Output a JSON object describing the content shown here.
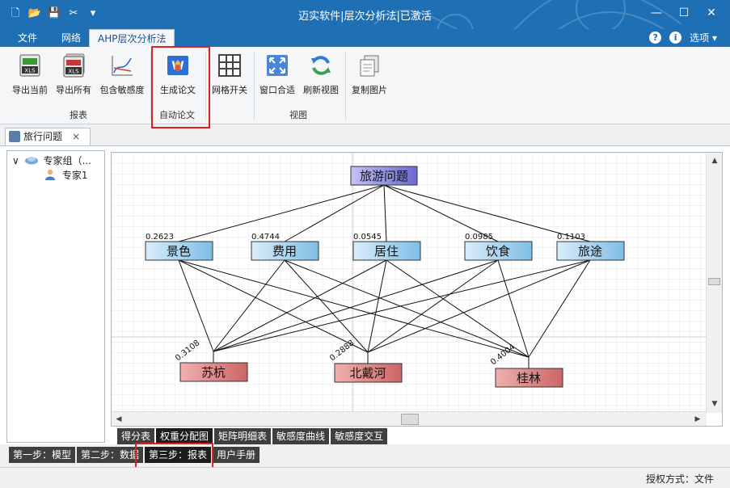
{
  "app": {
    "title": "迈实软件|层次分析法|已激活"
  },
  "menu": {
    "tabs": [
      "文件",
      "网络",
      "AHP层次分析法"
    ],
    "options_label": "选项"
  },
  "ribbon": {
    "buttons": {
      "export_current": "导出当前",
      "export_all": "导出所有",
      "include_sensitivity": "包含敏感度",
      "generate_paper": "生成论文",
      "grid_toggle": "网格开关",
      "fit_window": "窗口合适",
      "refresh_view": "刷新视图",
      "copy_image": "复制图片"
    },
    "groups": {
      "report": "报表",
      "auto_paper": "自动论文",
      "view": "视图"
    }
  },
  "document_tab": {
    "label": "旅行问题",
    "close": "×"
  },
  "tree": {
    "root": "专家组（...",
    "child": "专家1"
  },
  "hierarchy": {
    "goal": "旅游问题",
    "criteria": [
      {
        "name": "景色",
        "weight": "0.2623"
      },
      {
        "name": "费用",
        "weight": "0.4744"
      },
      {
        "name": "居住",
        "weight": "0.0545"
      },
      {
        "name": "饮食",
        "weight": "0.0985"
      },
      {
        "name": "旅途",
        "weight": "0.1103"
      }
    ],
    "alternatives": [
      {
        "name": "苏杭",
        "weight": "0.3108"
      },
      {
        "name": "北戴河",
        "weight": "0.2888"
      },
      {
        "name": "桂林",
        "weight": "0.4004"
      }
    ]
  },
  "sub_tabs": [
    "得分表",
    "权重分配图",
    "矩阵明细表",
    "敏感度曲线",
    "敏感度交互"
  ],
  "sub_tab_selected": "权重分配图",
  "steps": [
    "第一步：模型",
    "第二步：数据",
    "第三步：报表",
    "用户手册"
  ],
  "step_selected": "第三步：报表",
  "status": {
    "license": "授权方式：文件"
  },
  "colors": {
    "accent": "#1f6fb5",
    "goal_box": "#7b78d8",
    "criteria_box": "#8fc3e6",
    "alt_box": "#d77a7a",
    "highlight": "#e02020"
  }
}
